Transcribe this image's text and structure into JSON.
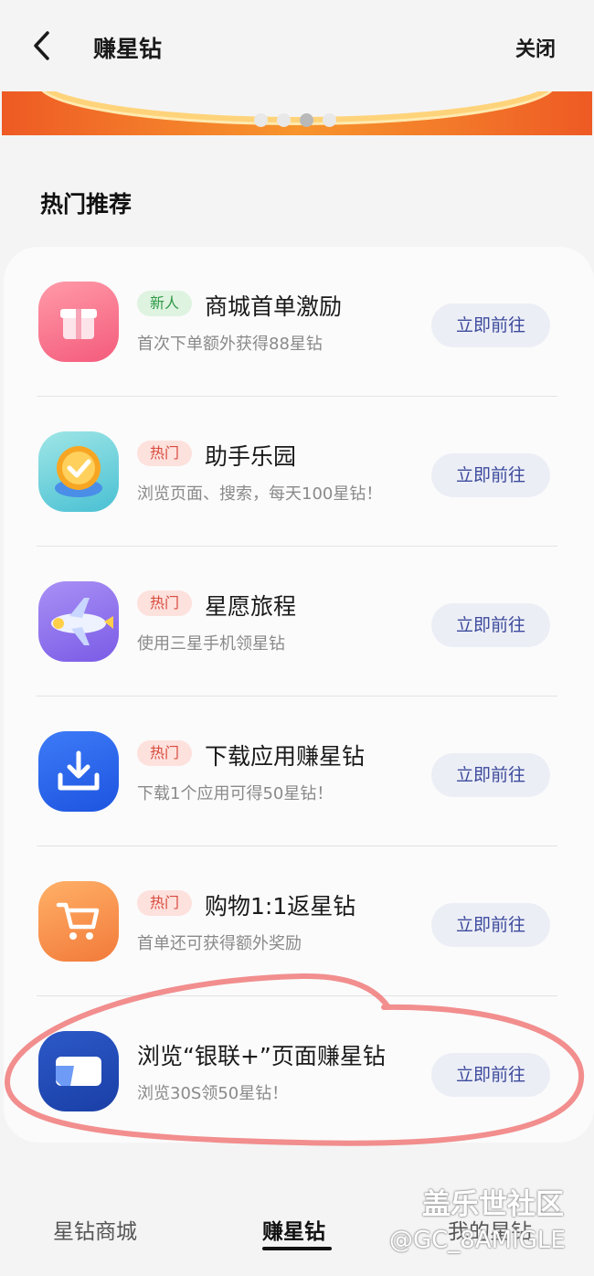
{
  "header": {
    "title": "赚星钻",
    "close_label": "关闭"
  },
  "section": {
    "title": "热门推荐"
  },
  "items": [
    {
      "tag": "新人",
      "title": "商城首单激励",
      "desc": "首次下单额外获得88星钻",
      "button": "立即前往",
      "icon": "gift-icon"
    },
    {
      "tag": "热门",
      "title": "助手乐园",
      "desc": "浏览页面、搜索，每天100星钻！",
      "button": "立即前往",
      "icon": "badge-check-icon"
    },
    {
      "tag": "热门",
      "title": "星愿旅程",
      "desc": "使用三星手机领星钻",
      "button": "立即前往",
      "icon": "airplane-icon"
    },
    {
      "tag": "热门",
      "title": "下载应用赚星钻",
      "desc": "下载1个应用可得50星钻！",
      "button": "立即前往",
      "icon": "download-icon"
    },
    {
      "tag": "热门",
      "title": "购物1:1返星钻",
      "desc": "首单还可获得额外奖励",
      "button": "立即前往",
      "icon": "cart-icon"
    },
    {
      "tag": "",
      "title": "浏览“银联+”页面赚星钻",
      "desc": "浏览30S领50星钻！",
      "button": "立即前往",
      "icon": "card-icon"
    }
  ],
  "bottom_nav": [
    {
      "label": "星钻商城",
      "active": false
    },
    {
      "label": "赚星钻",
      "active": true
    },
    {
      "label": "我的星钻",
      "active": false
    }
  ],
  "watermark": {
    "line1": "盖乐世社区",
    "line2": "@GC_8AMIGLE"
  },
  "colors": {
    "accent": "#3c4a9c",
    "annotation": "#f07a7a",
    "banner": "#ee5a24"
  }
}
